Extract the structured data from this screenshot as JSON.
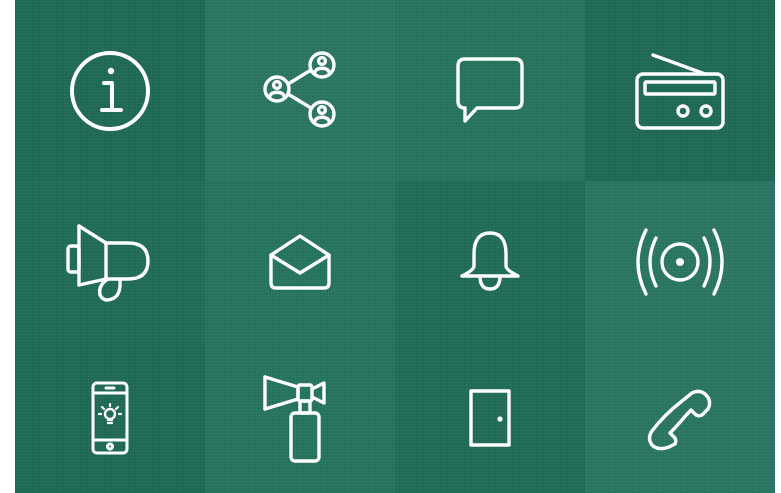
{
  "palette": {
    "background": "#1f6e59",
    "icon_stroke": "#ffffff"
  },
  "icons": [
    "info-icon",
    "network-share-icon",
    "chat-bubble-icon",
    "radio-icon",
    "megaphone-icon",
    "envelope-icon",
    "bell-icon",
    "alarm-signal-icon",
    "smartphone-light-icon",
    "air-horn-icon",
    "door-icon",
    "phone-handset-icon"
  ]
}
